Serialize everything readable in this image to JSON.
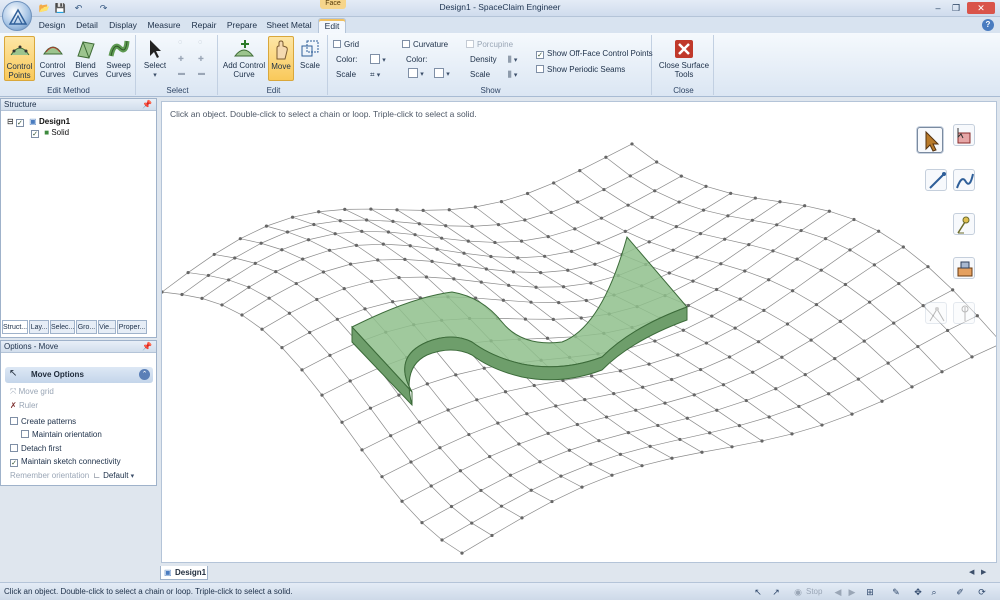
{
  "window": {
    "title": "Design1 - SpaceClaim Engineer",
    "context_tab": "Face",
    "minimize": "–",
    "restore": "❐",
    "close": "✕"
  },
  "quick_access": {
    "open": "📂",
    "save": "💾",
    "undo": "↶",
    "redo": "↷"
  },
  "tabs": [
    "Design",
    "Detail",
    "Display",
    "Measure",
    "Repair",
    "Prepare",
    "Sheet Metal",
    "Edit"
  ],
  "ribbon": {
    "edit_method": {
      "label": "Edit Method",
      "control_points": [
        "Control",
        "Points"
      ],
      "control_curves": [
        "Control",
        "Curves"
      ],
      "blend_curves": [
        "Blend",
        "Curves"
      ],
      "sweep_curves": [
        "Sweep",
        "Curves"
      ]
    },
    "select": {
      "label": "Select",
      "select_button": "Select"
    },
    "edit": {
      "label": "Edit",
      "add_control_curve": [
        "Add Control",
        "Curve"
      ],
      "move": "Move",
      "scale": "Scale"
    },
    "show": {
      "label": "Show",
      "grid": "Grid",
      "grid_color": "Color:",
      "grid_scale": "Scale",
      "curvature": "Curvature",
      "curvature_color": "Color:",
      "porcupine": "Porcupine",
      "density": "Density",
      "scale": "Scale",
      "show_off_face": "Show Off-Face Control Points",
      "show_off_face_checked": true,
      "show_periodic_seams": "Show Periodic Seams",
      "show_periodic_seams_checked": false
    },
    "close": {
      "label": "Close",
      "close_surface_tools": [
        "Close Surface",
        "Tools"
      ]
    }
  },
  "structure": {
    "title": "Structure",
    "root": "Design1",
    "child": "Solid",
    "panel_tabs": [
      "Struct...",
      "Lay...",
      "Selec...",
      "Gro...",
      "Vie...",
      "Proper..."
    ]
  },
  "options": {
    "title": "Options - Move",
    "section": "Move Options",
    "move_grid": "Move grid",
    "ruler": "Ruler",
    "create_patterns": "Create patterns",
    "maintain_orientation": "Maintain orientation",
    "detach_first": "Detach first",
    "maintain_sketch_connectivity": "Maintain sketch connectivity",
    "remember_orientation": "Remember orientation",
    "default": "Default",
    "create_patterns_checked": false,
    "maintain_orientation_checked": false,
    "detach_first_checked": false,
    "maintain_sketch_connectivity_checked": true
  },
  "viewport": {
    "hint": "Click an object.  Double-click to select a chain or loop.  Triple-click to select a solid.",
    "surface_color": "#8fbf8c",
    "grid_color": "#8a8a8a"
  },
  "document_tab": "Design1",
  "status": {
    "text": "Click an object.  Double-click to select a chain or loop.  Triple-click to select a solid.",
    "stop": "Stop"
  },
  "colors": {
    "accent": "#f9c95a",
    "ribbon": "#dbe6f3",
    "close_red": "#c0392b"
  }
}
